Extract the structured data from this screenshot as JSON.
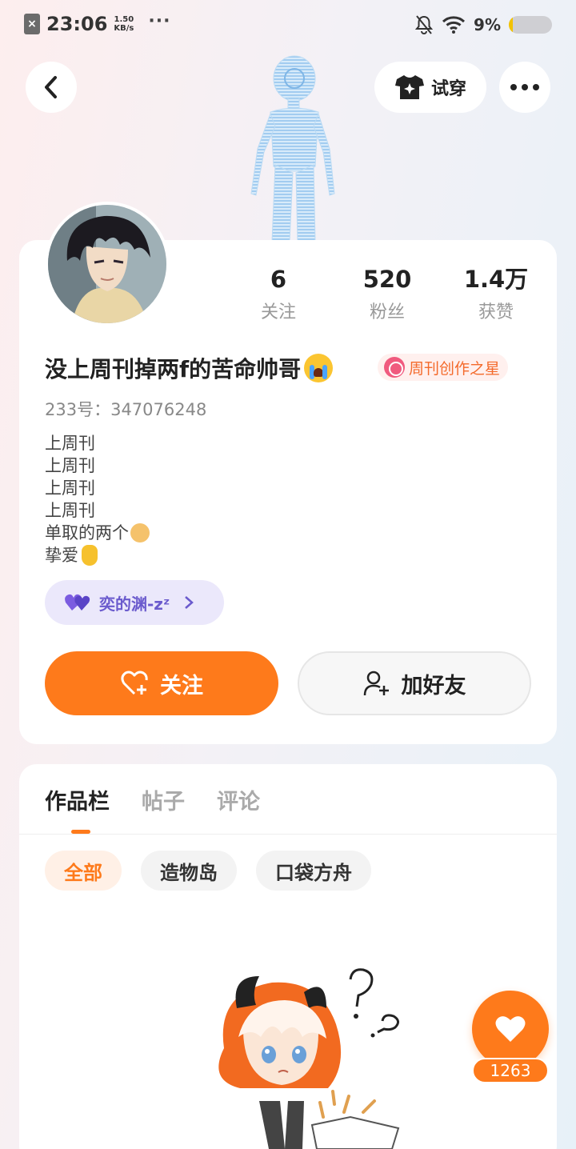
{
  "status_bar": {
    "time": "23:06",
    "speed_value": "1.50",
    "speed_unit": "KB/s",
    "more": "···",
    "battery_pct": "9%",
    "battery_level": 0.09,
    "sim_icon": "sim-off-icon",
    "bell_icon": "bell-off-icon",
    "wifi_icon": "wifi-icon"
  },
  "top_nav": {
    "back_icon": "chevron-left-icon",
    "try_on_label": "试穿",
    "more_icon": "more-horizontal-icon"
  },
  "profile": {
    "stats": [
      {
        "value": "6",
        "label": "关注"
      },
      {
        "value": "520",
        "label": "粉丝"
      },
      {
        "value": "1.4万",
        "label": "获赞"
      }
    ],
    "nickname": "没上周刊掉两f的苦命帅哥",
    "badge": "周刊创作之星",
    "uid": "233号：347076248",
    "bio_lines": [
      "上周刊",
      "上周刊",
      "上周刊",
      "上周刊",
      "单取的两个",
      "挚爱"
    ],
    "relation_label": "奕的渊-zᶻ",
    "follow_label": "关注",
    "add_friend_label": "加好友"
  },
  "content": {
    "tabs": [
      "作品栏",
      "帖子",
      "评论"
    ],
    "active_tab": 0,
    "chips": [
      "全部",
      "造物岛",
      "口袋方舟"
    ],
    "active_chip": 0
  },
  "like": {
    "count": "1263",
    "icon": "heart-icon"
  },
  "colors": {
    "accent": "#fe7a1b",
    "relation": "#6a5acd",
    "badge_text": "#f46a2b"
  }
}
